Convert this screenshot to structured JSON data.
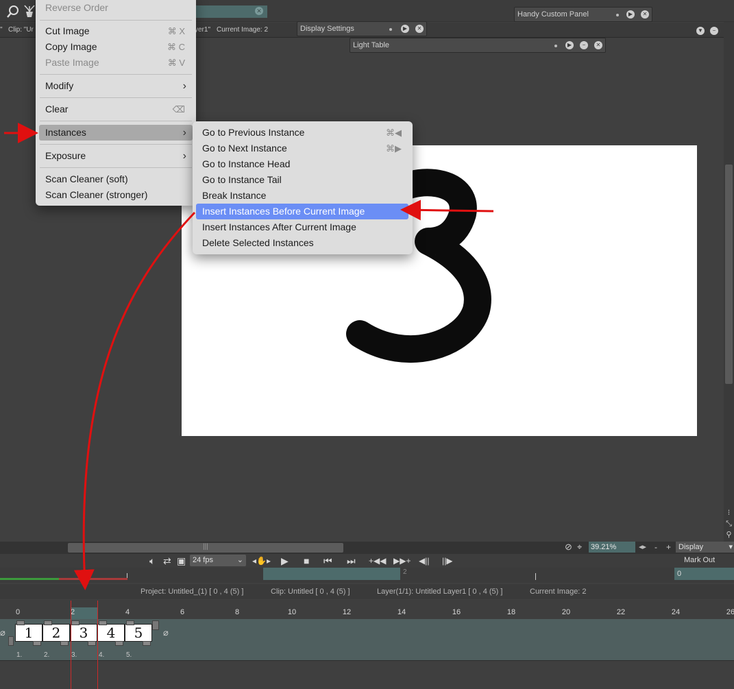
{
  "top": {
    "status_clip": "Clip: \"Ur",
    "status_prefix": "\"",
    "status_layer": "yer1\"",
    "status_current": "Current Image: 2",
    "panels": {
      "handy_custom": "Handy Custom Panel",
      "display_settings": "Display Settings",
      "light_table": "Light Table"
    }
  },
  "context_menu": {
    "reverse_order": "Reverse Order",
    "cut_image": "Cut Image",
    "cut_sc": "⌘ X",
    "copy_image": "Copy Image",
    "copy_sc": "⌘ C",
    "paste_image": "Paste Image",
    "paste_sc": "⌘ V",
    "modify": "Modify",
    "clear": "Clear",
    "instances": "Instances",
    "exposure": "Exposure",
    "scan_soft": "Scan Cleaner (soft)",
    "scan_stronger": "Scan Cleaner (stronger)"
  },
  "instances_submenu": {
    "prev": "Go to Previous Instance",
    "prev_sc": "⌘◀",
    "next": "Go to Next Instance",
    "next_sc": "⌘▶",
    "head": "Go to Instance Head",
    "tail": "Go to Instance Tail",
    "break": "Break Instance",
    "insert_before": "Insert Instances Before Current Image",
    "insert_after": "Insert Instances After Current Image",
    "delete": "Delete Selected Instances"
  },
  "playback": {
    "fps": "24 fps",
    "zoom": "39.21%",
    "display": "Display",
    "mark_out": "Mark Out",
    "mark_out_value": "0",
    "mark_range_label": "2"
  },
  "info": {
    "project": "Project: Untitled_(1) [ 0 , 4  (5) ]",
    "clip": "Clip: Untitled [ 0 , 4  (5) ]",
    "layer": "Layer(1/1): Untitled Layer1 [ 0 , 4  (5) ]",
    "current": "Current Image: 2"
  },
  "timeline": {
    "ticks": [
      "0",
      "2",
      "4",
      "6",
      "8",
      "10",
      "12",
      "14",
      "16",
      "18",
      "20",
      "22",
      "24",
      "26"
    ],
    "cells": [
      "1",
      "2",
      "3",
      "4",
      "5"
    ],
    "cell_labels": [
      "1.",
      "2.",
      "3.",
      "4.",
      "5."
    ]
  },
  "canvas": {
    "digit": "3"
  },
  "colors": {
    "highlight": "#6b8ef5",
    "teal": "#4d6b6b",
    "annotation_red": "#e01010"
  }
}
